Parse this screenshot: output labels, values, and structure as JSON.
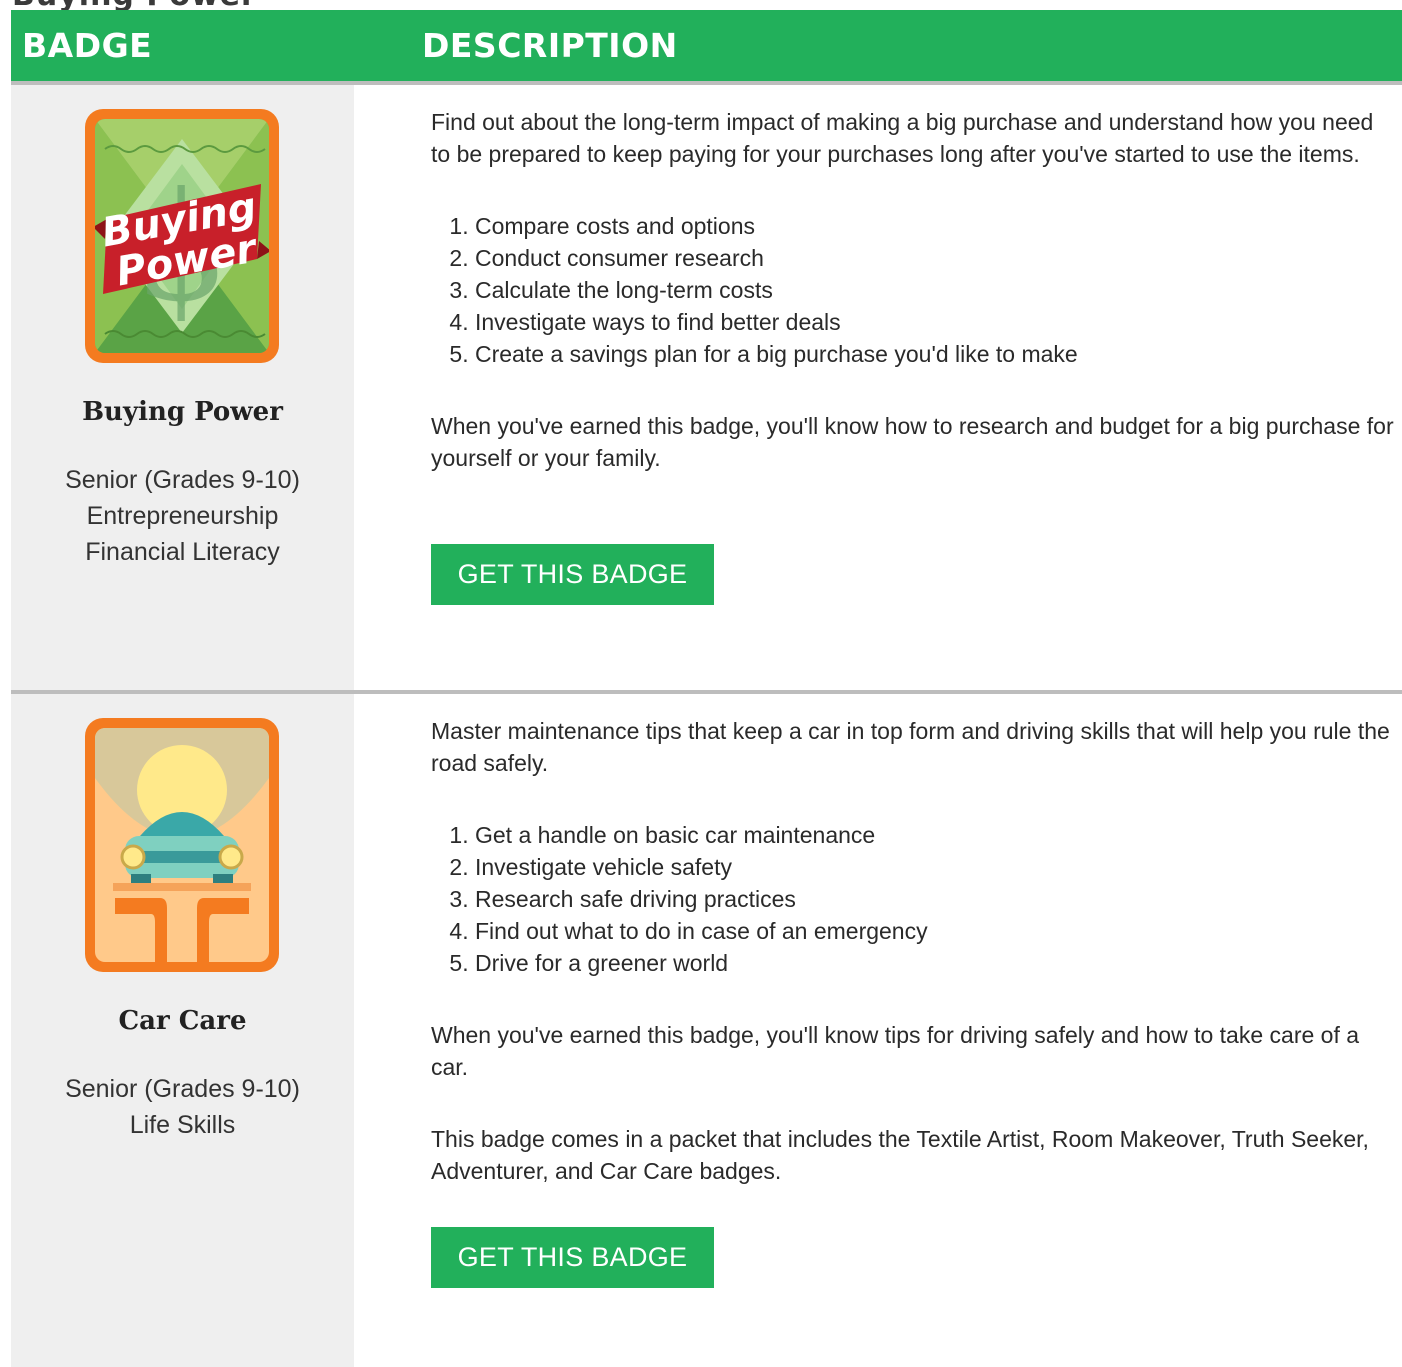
{
  "page_title": "Buying Power",
  "table": {
    "header_badge": "BADGE",
    "header_description": "DESCRIPTION"
  },
  "badges": [
    {
      "name": "Buying Power",
      "badge_art_text": [
        "Buying",
        "Power"
      ],
      "level": "Senior (Grades 9-10)",
      "categories": [
        "Entrepreneurship",
        "Financial Literacy"
      ],
      "intro": "Find out about the long-term impact of making a big purchase and understand how you need to be prepared to keep paying for your purchases long after you've started to use the items.",
      "steps": [
        "Compare costs and options",
        "Conduct consumer research",
        "Calculate the long-term costs",
        "Investigate ways to find better deals",
        "Create a savings plan for a big purchase you'd like to make"
      ],
      "outcome": "When you've earned this badge, you'll know how to research and budget for a big purchase for yourself or your family.",
      "button_label": "GET THIS BADGE",
      "icon": "buying-power-badge-icon"
    },
    {
      "name": "Car Care",
      "level": "Senior (Grades 9-10)",
      "categories": [
        "Life Skills"
      ],
      "intro": "Master maintenance tips that keep a car in top form and driving skills that will help you rule the road safely.",
      "steps": [
        "Get a handle on basic car maintenance",
        "Investigate vehicle safety",
        "Research safe driving practices",
        "Find out what to do in case of an emergency",
        "Drive for a greener world"
      ],
      "outcome": "When you've earned this badge, you'll know tips for driving safely and how to take care of a car.",
      "note": "This badge comes in a packet that includes the Textile Artist, Room Makeover, Truth Seeker, Adventurer, and Car Care badges.",
      "button_label": "GET THIS BADGE",
      "icon": "car-care-badge-icon"
    }
  ],
  "colors": {
    "header_green": "#22b05b",
    "button_green": "#22b05b",
    "badge_orange": "#f47b20",
    "badge_cell_bg": "#efefef"
  }
}
